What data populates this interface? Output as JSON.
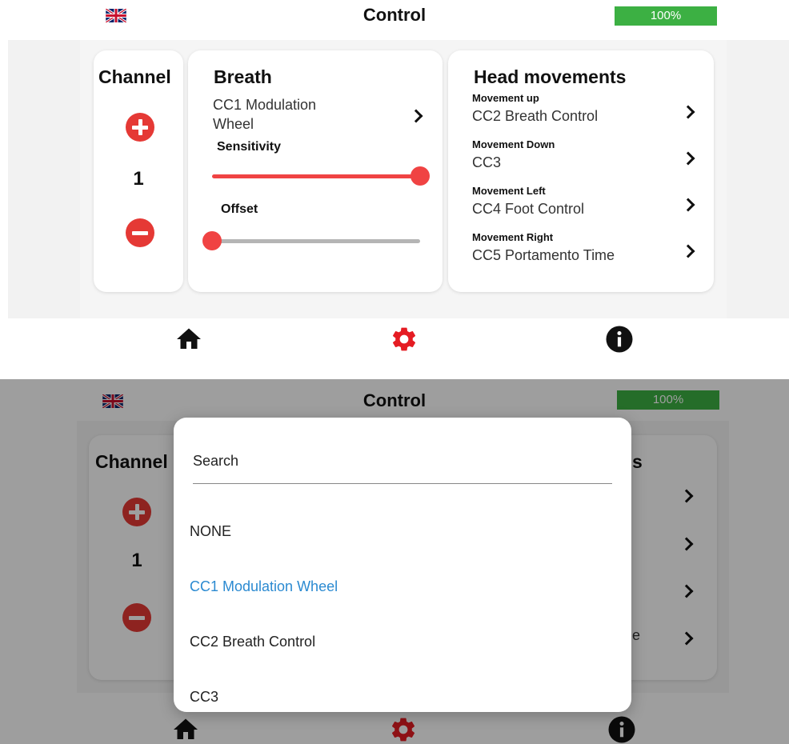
{
  "app": {
    "title": "Control",
    "battery": "100%",
    "flag_icon": "uk-flag-icon",
    "accent_color": "#e53935",
    "battery_color": "#3cb043",
    "selected_color": "#2b8ad1"
  },
  "channel": {
    "heading": "Channel",
    "value": "1",
    "increment_icon": "plus-circle-icon",
    "decrement_icon": "minus-circle-icon"
  },
  "breath": {
    "heading": "Breath",
    "mapping_line1": "CC1 Modulation",
    "mapping_line2": "Wheel",
    "sensitivity_label": "Sensitivity",
    "sensitivity_level": 1.0,
    "offset_label": "Offset",
    "offset_level": 0.0
  },
  "head": {
    "heading": "Head movements",
    "items": [
      {
        "label": "Movement up",
        "value": "CC2 Breath Control"
      },
      {
        "label": "Movement Down",
        "value": "CC3"
      },
      {
        "label": "Movement Left",
        "value": "CC4 Foot Control"
      },
      {
        "label": "Movement Right",
        "value": "CC5 Portamento Time"
      }
    ]
  },
  "nav": {
    "items": [
      {
        "icon": "home-icon",
        "active": false
      },
      {
        "icon": "gear-icon",
        "active": true
      },
      {
        "icon": "info-icon",
        "active": false
      }
    ]
  },
  "picker": {
    "search_placeholder": "Search",
    "options": [
      "NONE",
      "CC1 Modulation Wheel",
      "CC2 Breath Control",
      "CC3"
    ],
    "selected": "CC1 Modulation Wheel"
  },
  "background_fragments": {
    "head_heading_tail": "s",
    "right_item_tail": "e"
  }
}
